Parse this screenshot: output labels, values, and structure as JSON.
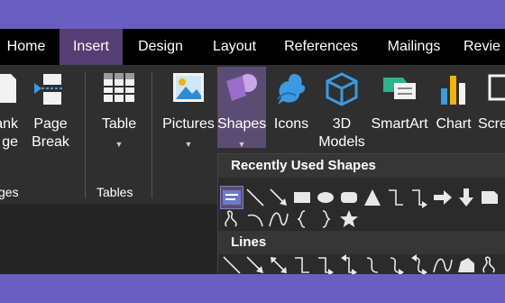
{
  "tabs": [
    {
      "label": "Home"
    },
    {
      "label": "Insert",
      "active": true
    },
    {
      "label": "Design"
    },
    {
      "label": "Layout"
    },
    {
      "label": "References"
    },
    {
      "label": "Mailings"
    },
    {
      "label": "Revie"
    }
  ],
  "ribbon": {
    "blank_page": {
      "line1": "ank",
      "line2": "ge"
    },
    "page_break": {
      "line1": "Page",
      "line2": "Break"
    },
    "pages_group": "ges",
    "table": {
      "label": "Table"
    },
    "tables_group": "Tables",
    "pictures": {
      "label": "Pictures"
    },
    "shapes": {
      "label": "Shapes"
    },
    "icons": {
      "label": "Icons"
    },
    "models": {
      "line1": "3D",
      "line2": "Models"
    },
    "smartart": {
      "label": "SmartArt"
    },
    "chart": {
      "label": "Chart"
    },
    "screenshot": {
      "label": "Scre"
    }
  },
  "dropdown": {
    "recent_title": "Recently Used Shapes",
    "lines_title": "Lines"
  },
  "colors": {
    "accent": "#553e74",
    "window_bg": "#6a5fc1"
  }
}
